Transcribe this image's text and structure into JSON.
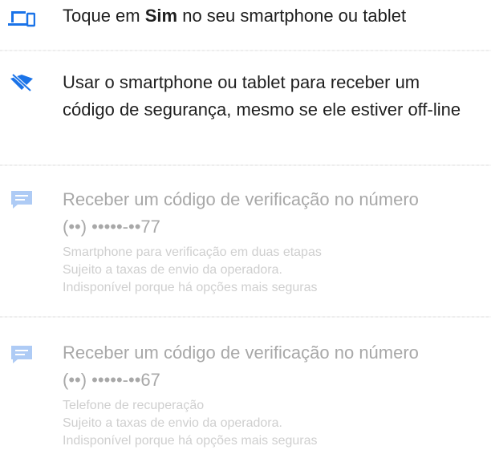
{
  "options": [
    {
      "icon": "devices-icon",
      "title_prefix": "Toque em ",
      "title_bold": "Sim",
      "title_suffix": " no seu smartphone ou tablet",
      "enabled": true
    },
    {
      "icon": "phone-offline-icon",
      "title": "Usar o smartphone ou tablet para receber um código de segurança, mesmo se ele estiver off-line",
      "enabled": true
    },
    {
      "icon": "sms-icon",
      "title": "Receber um código de verificação no número",
      "number": "(••) •••••-••77",
      "details": [
        "Smartphone para verificação em duas etapas",
        "Sujeito a taxas de envio da operadora.",
        "Indisponível porque há opções mais seguras"
      ],
      "enabled": false
    },
    {
      "icon": "sms-icon",
      "title": "Receber um código de verificação no número",
      "number": "(••) •••••-••67",
      "details": [
        "Telefone de recuperação",
        "Sujeito a taxas de envio da operadora.",
        "Indisponível porque há opções mais seguras"
      ],
      "enabled": false
    }
  ],
  "colors": {
    "accent": "#1a73e8",
    "disabled_icon": "#aecbf5",
    "text": "#1f1f1f",
    "disabled_title": "#a8a8a8",
    "disabled_detail": "#cfcfcf"
  }
}
